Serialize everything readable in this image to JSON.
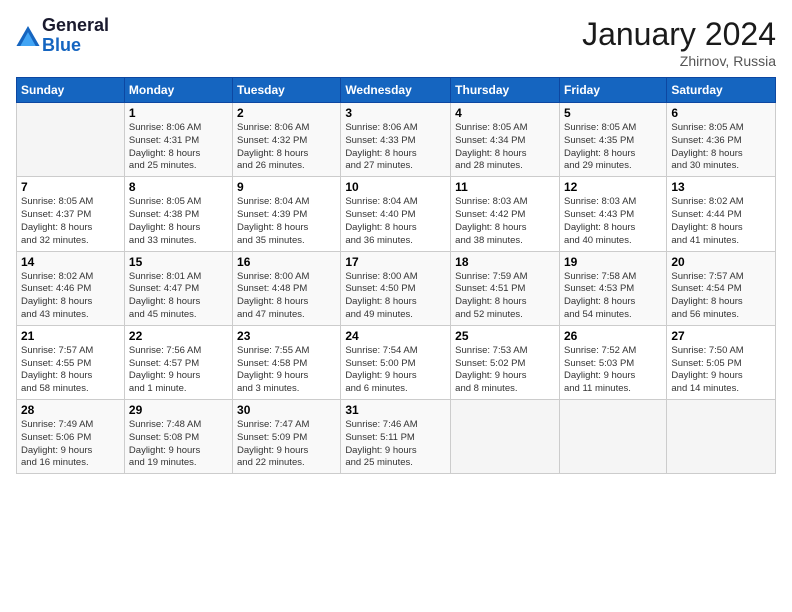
{
  "header": {
    "logo_line1": "General",
    "logo_line2": "Blue",
    "month": "January 2024",
    "location": "Zhirnov, Russia"
  },
  "weekdays": [
    "Sunday",
    "Monday",
    "Tuesday",
    "Wednesday",
    "Thursday",
    "Friday",
    "Saturday"
  ],
  "weeks": [
    [
      {
        "day": "",
        "info": ""
      },
      {
        "day": "1",
        "info": "Sunrise: 8:06 AM\nSunset: 4:31 PM\nDaylight: 8 hours\nand 25 minutes."
      },
      {
        "day": "2",
        "info": "Sunrise: 8:06 AM\nSunset: 4:32 PM\nDaylight: 8 hours\nand 26 minutes."
      },
      {
        "day": "3",
        "info": "Sunrise: 8:06 AM\nSunset: 4:33 PM\nDaylight: 8 hours\nand 27 minutes."
      },
      {
        "day": "4",
        "info": "Sunrise: 8:05 AM\nSunset: 4:34 PM\nDaylight: 8 hours\nand 28 minutes."
      },
      {
        "day": "5",
        "info": "Sunrise: 8:05 AM\nSunset: 4:35 PM\nDaylight: 8 hours\nand 29 minutes."
      },
      {
        "day": "6",
        "info": "Sunrise: 8:05 AM\nSunset: 4:36 PM\nDaylight: 8 hours\nand 30 minutes."
      }
    ],
    [
      {
        "day": "7",
        "info": "Sunrise: 8:05 AM\nSunset: 4:37 PM\nDaylight: 8 hours\nand 32 minutes."
      },
      {
        "day": "8",
        "info": "Sunrise: 8:05 AM\nSunset: 4:38 PM\nDaylight: 8 hours\nand 33 minutes."
      },
      {
        "day": "9",
        "info": "Sunrise: 8:04 AM\nSunset: 4:39 PM\nDaylight: 8 hours\nand 35 minutes."
      },
      {
        "day": "10",
        "info": "Sunrise: 8:04 AM\nSunset: 4:40 PM\nDaylight: 8 hours\nand 36 minutes."
      },
      {
        "day": "11",
        "info": "Sunrise: 8:03 AM\nSunset: 4:42 PM\nDaylight: 8 hours\nand 38 minutes."
      },
      {
        "day": "12",
        "info": "Sunrise: 8:03 AM\nSunset: 4:43 PM\nDaylight: 8 hours\nand 40 minutes."
      },
      {
        "day": "13",
        "info": "Sunrise: 8:02 AM\nSunset: 4:44 PM\nDaylight: 8 hours\nand 41 minutes."
      }
    ],
    [
      {
        "day": "14",
        "info": "Sunrise: 8:02 AM\nSunset: 4:46 PM\nDaylight: 8 hours\nand 43 minutes."
      },
      {
        "day": "15",
        "info": "Sunrise: 8:01 AM\nSunset: 4:47 PM\nDaylight: 8 hours\nand 45 minutes."
      },
      {
        "day": "16",
        "info": "Sunrise: 8:00 AM\nSunset: 4:48 PM\nDaylight: 8 hours\nand 47 minutes."
      },
      {
        "day": "17",
        "info": "Sunrise: 8:00 AM\nSunset: 4:50 PM\nDaylight: 8 hours\nand 49 minutes."
      },
      {
        "day": "18",
        "info": "Sunrise: 7:59 AM\nSunset: 4:51 PM\nDaylight: 8 hours\nand 52 minutes."
      },
      {
        "day": "19",
        "info": "Sunrise: 7:58 AM\nSunset: 4:53 PM\nDaylight: 8 hours\nand 54 minutes."
      },
      {
        "day": "20",
        "info": "Sunrise: 7:57 AM\nSunset: 4:54 PM\nDaylight: 8 hours\nand 56 minutes."
      }
    ],
    [
      {
        "day": "21",
        "info": "Sunrise: 7:57 AM\nSunset: 4:55 PM\nDaylight: 8 hours\nand 58 minutes."
      },
      {
        "day": "22",
        "info": "Sunrise: 7:56 AM\nSunset: 4:57 PM\nDaylight: 9 hours\nand 1 minute."
      },
      {
        "day": "23",
        "info": "Sunrise: 7:55 AM\nSunset: 4:58 PM\nDaylight: 9 hours\nand 3 minutes."
      },
      {
        "day": "24",
        "info": "Sunrise: 7:54 AM\nSunset: 5:00 PM\nDaylight: 9 hours\nand 6 minutes."
      },
      {
        "day": "25",
        "info": "Sunrise: 7:53 AM\nSunset: 5:02 PM\nDaylight: 9 hours\nand 8 minutes."
      },
      {
        "day": "26",
        "info": "Sunrise: 7:52 AM\nSunset: 5:03 PM\nDaylight: 9 hours\nand 11 minutes."
      },
      {
        "day": "27",
        "info": "Sunrise: 7:50 AM\nSunset: 5:05 PM\nDaylight: 9 hours\nand 14 minutes."
      }
    ],
    [
      {
        "day": "28",
        "info": "Sunrise: 7:49 AM\nSunset: 5:06 PM\nDaylight: 9 hours\nand 16 minutes."
      },
      {
        "day": "29",
        "info": "Sunrise: 7:48 AM\nSunset: 5:08 PM\nDaylight: 9 hours\nand 19 minutes."
      },
      {
        "day": "30",
        "info": "Sunrise: 7:47 AM\nSunset: 5:09 PM\nDaylight: 9 hours\nand 22 minutes."
      },
      {
        "day": "31",
        "info": "Sunrise: 7:46 AM\nSunset: 5:11 PM\nDaylight: 9 hours\nand 25 minutes."
      },
      {
        "day": "",
        "info": ""
      },
      {
        "day": "",
        "info": ""
      },
      {
        "day": "",
        "info": ""
      }
    ]
  ]
}
